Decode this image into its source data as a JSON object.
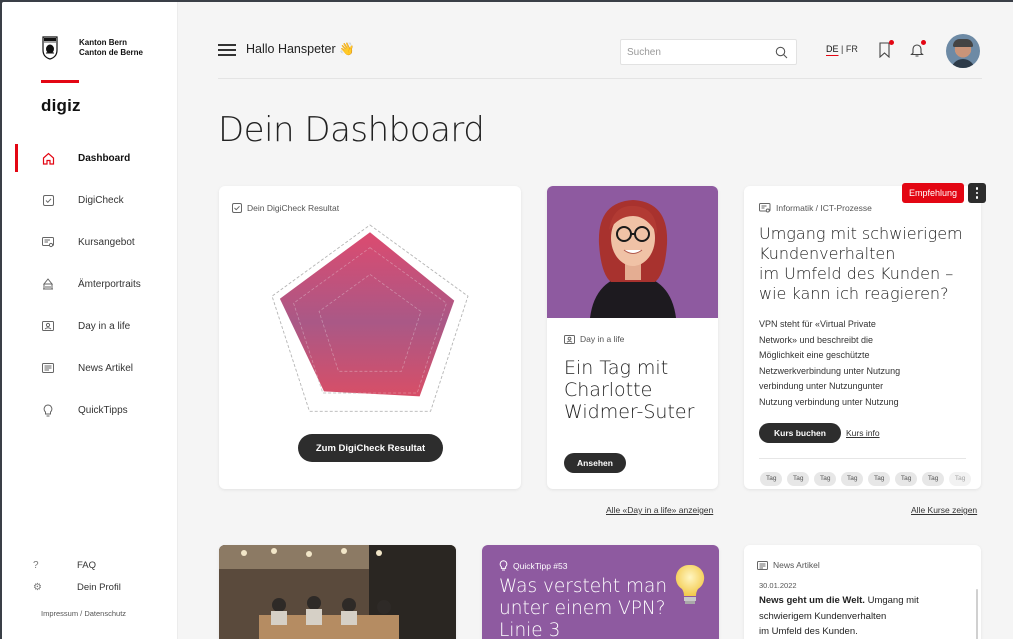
{
  "sidebar": {
    "canton_line1": "Kanton Bern",
    "canton_line2": "Canton de Berne",
    "brand": "digiz",
    "items": [
      {
        "label": "Dashboard",
        "icon": "home-icon"
      },
      {
        "label": "DigiCheck",
        "icon": "checkbox-icon"
      },
      {
        "label": "Kursangebot",
        "icon": "certificate-icon"
      },
      {
        "label": "Ämterportraits",
        "icon": "building-icon"
      },
      {
        "label": "Day in a life",
        "icon": "id-card-icon"
      },
      {
        "label": "News Artikel",
        "icon": "newspaper-icon"
      },
      {
        "label": "QuickTipps",
        "icon": "lightbulb-icon"
      }
    ],
    "footer": [
      {
        "label": "FAQ",
        "icon": "question-icon"
      },
      {
        "label": "Dein Profil",
        "icon": "gear-icon"
      }
    ],
    "imprint": "Impressum / Datenschutz"
  },
  "header": {
    "greeting": "Hallo Hanspeter 👋",
    "search_placeholder": "Suchen",
    "lang_current": "DE",
    "lang_sep": "|",
    "lang_other": "FR"
  },
  "page_title": "Dein Dashboard",
  "digicheck_card": {
    "tag": "Dein DigiCheck Resultat",
    "button": "Zum DigiCheck Resultat",
    "chart_data": {
      "type": "radar",
      "axes": 5,
      "values": [
        0.93,
        0.86,
        0.82,
        0.76,
        0.92
      ],
      "max": 1
    }
  },
  "day_card": {
    "tag": "Day in a life",
    "title_line1": "Ein Tag mit",
    "title_line2": "Charlotte",
    "title_line3": "Widmer-Suter",
    "button": "Ansehen",
    "link_below": "Alle «Day in a life» anzeigen"
  },
  "course_card": {
    "badge": "Empfehlung",
    "tag": "Informatik / ICT-Prozesse",
    "title_line1": "Umgang mit schwierigem",
    "title_line2": "Kundenverhalten",
    "title_line3": "im Umfeld des Kunden –",
    "title_line4": "wie kann ich reagieren?",
    "body_line1": "VPN steht für «Virtual Private",
    "body_line2": "Network» und beschreibt die",
    "body_line3": "Möglichkeit eine geschützte",
    "body_line4": "Netzwerkverbindung unter Nutzung",
    "body_line5": "verbindung unter Nutzungunter",
    "body_line6": "Nutzung verbindung unter Nutzung",
    "button": "Kurs buchen",
    "info_link": "Kurs info",
    "tags": [
      "Tag",
      "Tag",
      "Tag",
      "Tag",
      "Tag",
      "Tag",
      "Tag",
      "Tag"
    ],
    "link_below": "Alle Kurse zeigen"
  },
  "quicktipp_card": {
    "tag": "QuickTipp #53",
    "title_line1": "Was versteht man",
    "title_line2": "unter einem VPN?",
    "title_line3": "Linie 3"
  },
  "news_card": {
    "tag": "News Artikel",
    "date": "30.01.2022",
    "headline": "News geht um die Welt.",
    "text_line1_rest": " Umgang mit",
    "text_line2": "schwierigem Kundenverhalten",
    "text_line3": "im Umfeld des Kunden."
  },
  "colors": {
    "accent_red": "#e30613",
    "quicktipp_purple": "#8e5aa0",
    "dark_button": "#2d2d2d"
  }
}
